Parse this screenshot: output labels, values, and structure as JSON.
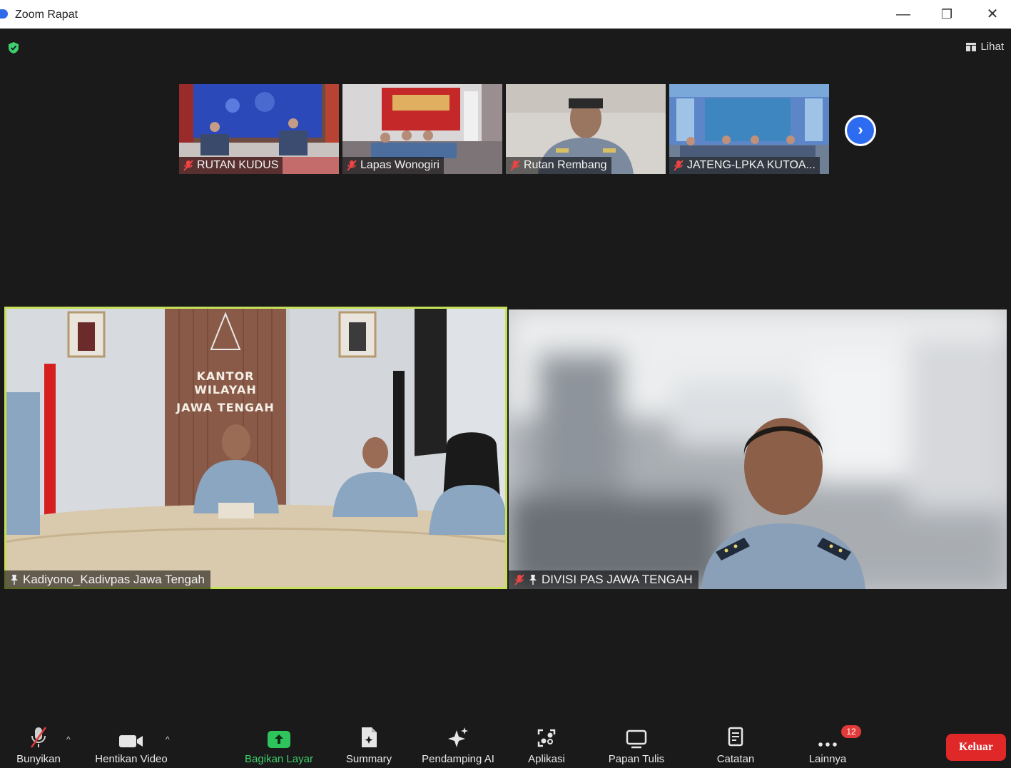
{
  "window": {
    "title": "Zoom Rapat",
    "minimize": "—",
    "restore": "❐",
    "close": "✕"
  },
  "header": {
    "view_label": "Lihat"
  },
  "thumbnails": [
    {
      "name": "RUTAN KUDUS"
    },
    {
      "name": "Lapas Wonogiri"
    },
    {
      "name": "Rutan Rembang"
    },
    {
      "name": "JATENG-LPKA KUTOA..."
    }
  ],
  "gallery": {
    "next_icon": "›"
  },
  "tiles": {
    "left": {
      "name": "Kadiyono_Kadivpas Jawa Tengah",
      "sign_line1": "KANTOR WILAYAH",
      "sign_line2": "JAWA TENGAH"
    },
    "right": {
      "name": "DIVISI PAS JAWA TENGAH"
    }
  },
  "toolbar": {
    "unmute": "Bunyikan",
    "stop_video": "Hentikan Video",
    "share_screen": "Bagikan Layar",
    "summary": "Summary",
    "ai_companion": "Pendamping AI",
    "apps": "Aplikasi",
    "whiteboard": "Papan Tulis",
    "notes": "Catatan",
    "more": "Lainnya",
    "more_badge": "12",
    "leave": "Keluar"
  },
  "colors": {
    "accent_green": "#3fcf6b",
    "active_speaker": "#c6e05a",
    "leave_red": "#e02828",
    "zoom_blue": "#2d6cf0"
  }
}
